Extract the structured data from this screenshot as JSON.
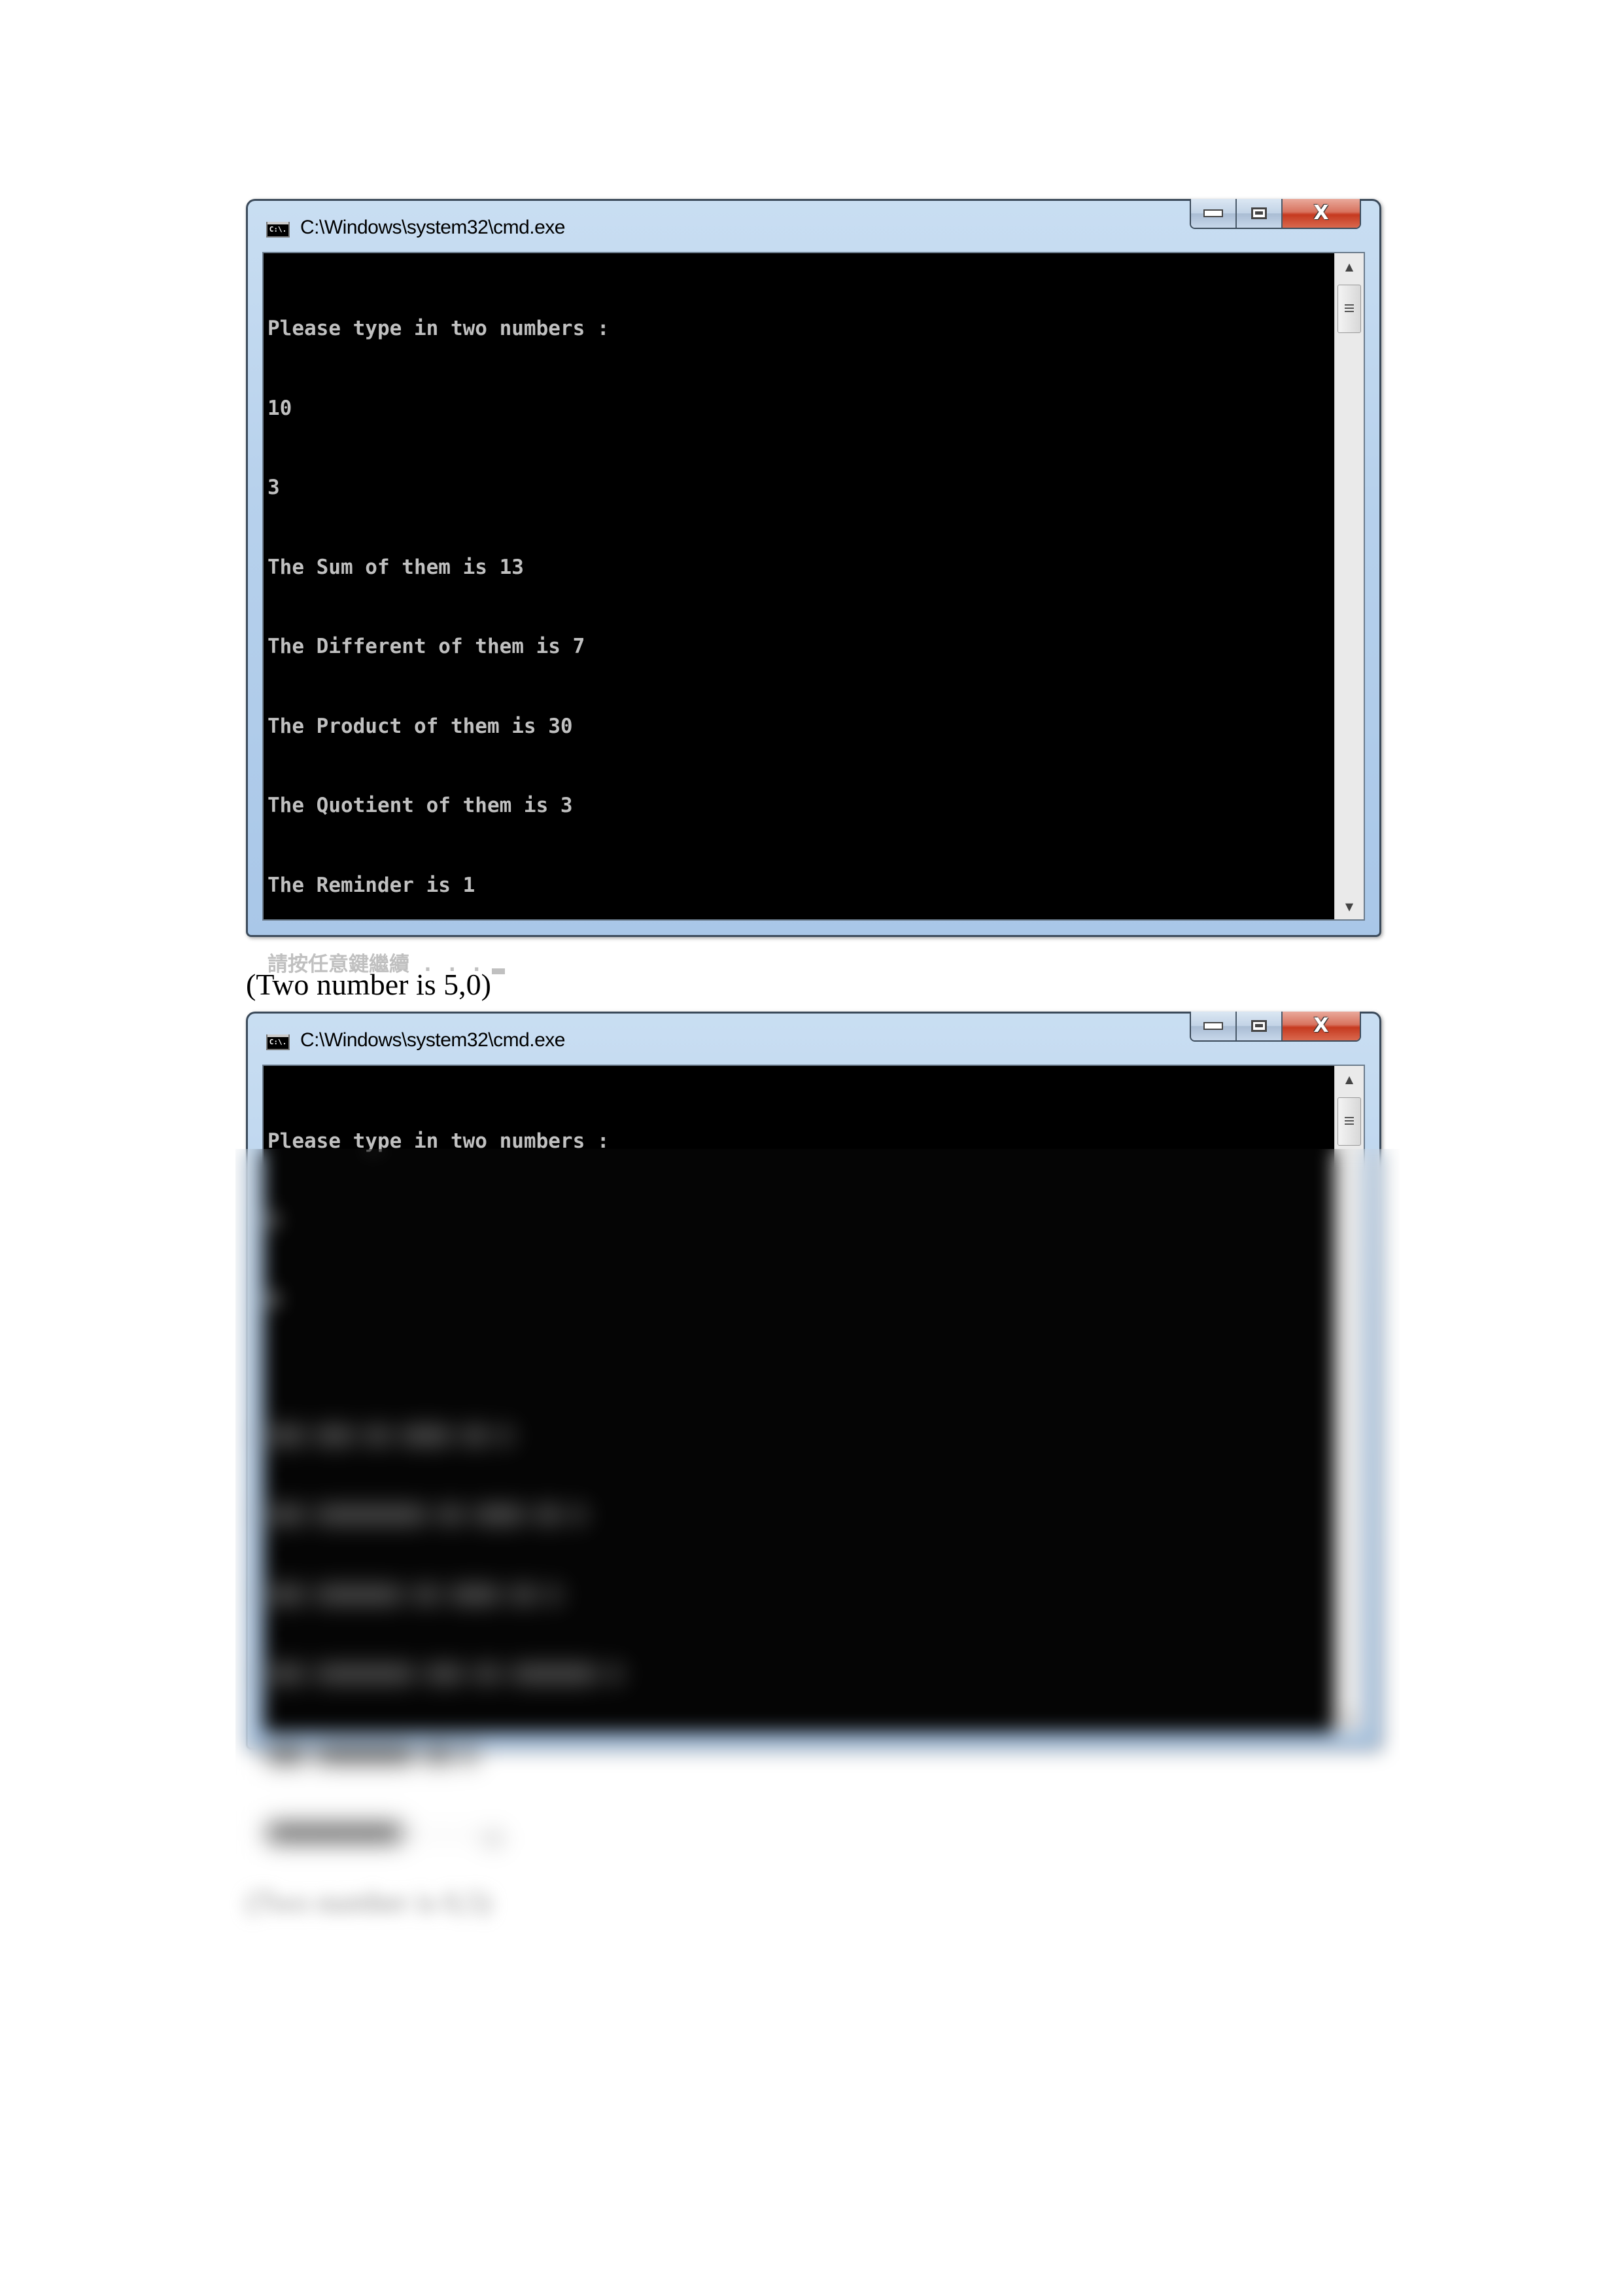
{
  "windows": [
    {
      "title": "C:\\Windows\\system32\\cmd.exe",
      "icon_label": "C:\\.",
      "console_lines": [
        "Please type in two numbers :",
        "10",
        "3",
        "The Sum of them is 13",
        "The Different of them is 7",
        "The Product of them is 30",
        "The Quotient of them is 3",
        "The Reminder is 1"
      ],
      "prompt": "請按任意鍵繼續 . . .",
      "blurred": false
    },
    {
      "title": "C:\\Windows\\system32\\cmd.exe",
      "icon_label": "C:\\.",
      "console_lines": [
        "Please type in two numbers :",
        "5",
        "0"
      ],
      "prompt": "",
      "blurred": true
    }
  ],
  "captions": [
    "(Two number is 5,0)",
    "(Two number is 0,5)"
  ],
  "caption_buttons": {
    "minimize": "minimize",
    "maximize": "maximize",
    "close": "X"
  },
  "scrollbar": {
    "up": "▲",
    "down": "▼"
  }
}
